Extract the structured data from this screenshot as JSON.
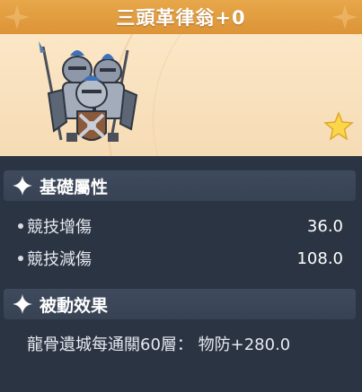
{
  "header": {
    "title": "三頭革律翁+0"
  },
  "banner": {
    "card_art_icon": "knight-squad-icon",
    "star_icon": "star-icon"
  },
  "sections": {
    "base_attributes": {
      "title": "基礎屬性",
      "stats": [
        {
          "label": "競技增傷",
          "value": "36.0"
        },
        {
          "label": "競技減傷",
          "value": "108.0"
        }
      ]
    },
    "passive": {
      "title": "被動效果",
      "text": "龍骨遺城每通關60層： 物防+280.0"
    }
  },
  "colors": {
    "title_bar": "#e09a3e",
    "banner_bg": "#f8e0bc",
    "panel_bg": "#2b3443",
    "section_header_bg": "#3c4859",
    "text": "#ffffff"
  }
}
